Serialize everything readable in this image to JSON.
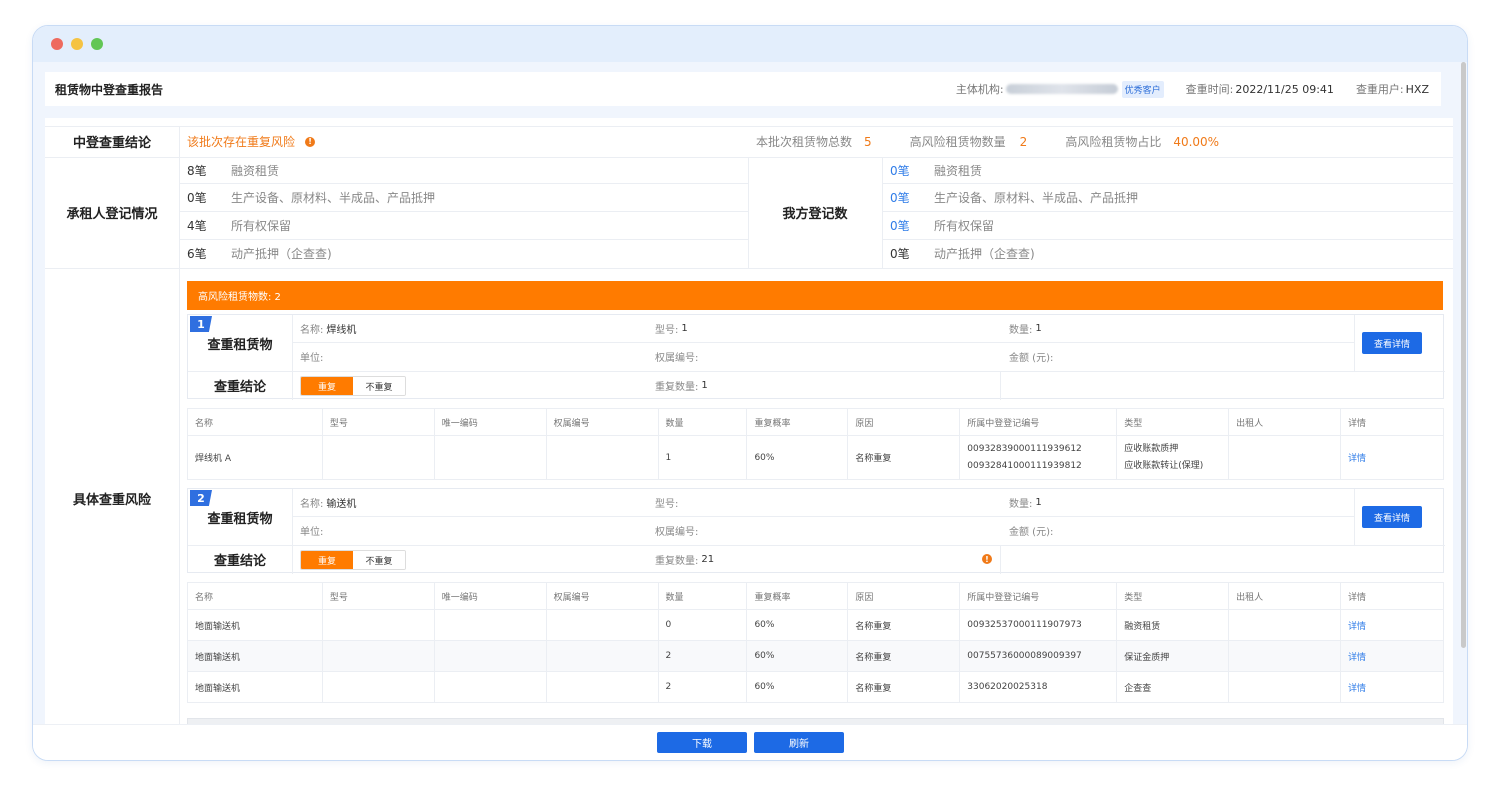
{
  "header": {
    "title": "租赁物中登查重报告",
    "org_label": "主体机构:",
    "org_badge": "优秀客户",
    "time_label": "查重时间:",
    "time_value": "2022/11/25 09:41",
    "user_label": "查重用户:",
    "user_value": "HXZ"
  },
  "conclusion": {
    "label": "中登查重结论",
    "status": "该批次存在重复风险",
    "total_label": "本批次租赁物总数",
    "total_value": "5",
    "high_label": "高风险租赁物数量",
    "high_value": "2",
    "ratio_label": "高风险租赁物占比",
    "ratio_value": "40.00%"
  },
  "lessee": {
    "label": "承租人登记情况",
    "rows": [
      {
        "count": "8笔",
        "name": "融资租赁"
      },
      {
        "count": "0笔",
        "name": "生产设备、原材料、半成品、产品抵押"
      },
      {
        "count": "4笔",
        "name": "所有权保留"
      },
      {
        "count": "6笔",
        "name": "动产抵押（企查查)"
      }
    ]
  },
  "ours": {
    "label": "我方登记数",
    "rows": [
      {
        "count": "0笔",
        "name": "融资租赁"
      },
      {
        "count": "0笔",
        "name": "生产设备、原材料、半成品、产品抵押"
      },
      {
        "count": "0笔",
        "name": "所有权保留"
      },
      {
        "count": "0笔",
        "name": "动产抵押（企查查)"
      }
    ]
  },
  "risk": {
    "label": "具体查重风险",
    "banner": "高风险租赁物数: 2",
    "item_title": "查重租赁物",
    "conclusion_title": "查重结论",
    "toggle_on": "重复",
    "toggle_off": "不重复",
    "detail_btn": "查看详情",
    "columns": [
      "名称",
      "型号",
      "唯一编码",
      "权属编号",
      "数量",
      "重复概率",
      "原因",
      "所属中登登记编号",
      "类型",
      "出租人",
      "详情"
    ],
    "items": [
      {
        "num": "1",
        "name_label": "名称:",
        "name": "焊线机",
        "model_label": "型号:",
        "model": "1",
        "qty_label": "数量:",
        "qty": "1",
        "unit_label": "单位:",
        "unit": "",
        "rights_label": "权属编号:",
        "rights": "",
        "amount_label": "金额 (元):",
        "amount": "",
        "dup_label": "重复数量:",
        "dup": "1",
        "rows": [
          {
            "name": "焊线机 A",
            "model": "",
            "code": "",
            "rights": "",
            "qty": "1",
            "prob": "60%",
            "reason": "名称重复",
            "reg": [
              "00932839000111939612",
              "00932841000111939812"
            ],
            "type": [
              "应收账款质押",
              "应收账款转让(保理)"
            ],
            "lessor": "",
            "detail": "详情"
          }
        ]
      },
      {
        "num": "2",
        "name_label": "名称:",
        "name": "输送机",
        "model_label": "型号:",
        "model": "",
        "qty_label": "数量:",
        "qty": "1",
        "unit_label": "单位:",
        "unit": "",
        "rights_label": "权属编号:",
        "rights": "",
        "amount_label": "金额 (元):",
        "amount": "",
        "dup_label": "重复数量:",
        "dup": "21",
        "rows": [
          {
            "name": "地面输送机",
            "model": "",
            "code": "",
            "rights": "",
            "qty": "0",
            "prob": "60%",
            "reason": "名称重复",
            "reg": [
              "00932537000111907973"
            ],
            "type": [
              "融资租赁"
            ],
            "lessor": "",
            "detail": "详情"
          },
          {
            "name": "地面输送机",
            "model": "",
            "code": "",
            "rights": "",
            "qty": "2",
            "prob": "60%",
            "reason": "名称重复",
            "reg": [
              "00755736000089009397"
            ],
            "type": [
              "保证金质押"
            ],
            "lessor": "",
            "detail": "详情"
          },
          {
            "name": "地面输送机",
            "model": "",
            "code": "",
            "rights": "",
            "qty": "2",
            "prob": "60%",
            "reason": "名称重复",
            "reg": [
              "33062020025318"
            ],
            "type": [
              "企查查"
            ],
            "lessor": "",
            "detail": "详情"
          }
        ]
      }
    ]
  },
  "footer": {
    "download": "下载",
    "refresh": "刷新"
  },
  "colors": {
    "accent_orange": "#ff7b00",
    "primary_blue": "#1d6ae5"
  }
}
